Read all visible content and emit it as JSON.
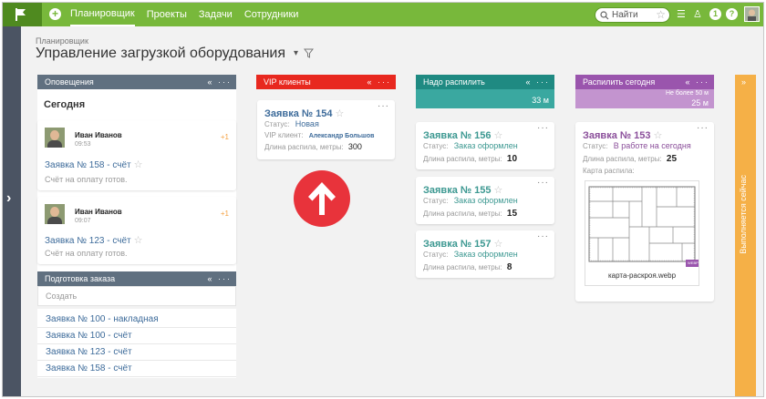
{
  "topbar": {
    "nav": [
      "Планировщик",
      "Проекты",
      "Задачи",
      "Сотрудники"
    ],
    "search_placeholder": "Найти",
    "notif_count": "1",
    "help": "?"
  },
  "header": {
    "breadcrumb": "Планировщик",
    "title": "Управление загрузкой оборудования"
  },
  "notifications": {
    "title": "Оповещения",
    "today": "Сегодня",
    "items": [
      {
        "name": "Иван Иванов",
        "time": "09:53",
        "count": "+1",
        "link": "Заявка № 158 - счёт",
        "text": "Счёт на оплату готов."
      },
      {
        "name": "Иван Иванов",
        "time": "09:07",
        "count": "+1",
        "link": "Заявка № 123 - счёт",
        "text": "Счёт на оплату готов."
      }
    ]
  },
  "prep": {
    "title": "Подготовка заказа",
    "create": "Создать",
    "items": [
      "Заявка № 100 - накладная",
      "Заявка № 100 - счёт",
      "Заявка № 123 - счёт",
      "Заявка № 158 - счёт"
    ]
  },
  "vip": {
    "title": "VIP клиенты",
    "card": {
      "title": "Заявка № 154",
      "status_label": "Статус:",
      "status": "Новая",
      "client_label": "VIP клиент:",
      "client": "Александр Большов",
      "length_label": "Длина распила, метры:",
      "length": "300"
    }
  },
  "need_cut": {
    "title": "Надо распилить",
    "summary": "33 м",
    "cards": [
      {
        "title": "Заявка № 156",
        "status_label": "Статус:",
        "status": "Заказ оформлен",
        "length_label": "Длина распила, метры:",
        "length": "10"
      },
      {
        "title": "Заявка № 155",
        "status_label": "Статус:",
        "status": "Заказ оформлен",
        "length_label": "Длина распила, метры:",
        "length": "15"
      },
      {
        "title": "Заявка № 157",
        "status_label": "Статус:",
        "status": "Заказ оформлен",
        "length_label": "Длина распила, метры:",
        "length": "8"
      }
    ]
  },
  "cut_today": {
    "title": "Распилить сегодня",
    "limit": "Не более 50 м",
    "summary": "25 м",
    "card": {
      "title": "Заявка № 153",
      "status_label": "Статус:",
      "status": "В работе на сегодня",
      "length_label": "Длина распила, метры:",
      "length": "25",
      "map_label": "Карта распила:",
      "file_name": "карта-раскроя.webp",
      "file_ext": "WEBP"
    }
  },
  "in_progress": {
    "title": "Выполняется сейчас"
  },
  "colors": {
    "green": "#78b83b",
    "gray_head": "#607080",
    "red_head": "#e8281f",
    "teal_head": "#1f8a82",
    "teal_summary": "#3aa8a0",
    "purple_head": "#9a55ad",
    "purple_summary": "#c394cf",
    "orange": "#f5b047"
  }
}
